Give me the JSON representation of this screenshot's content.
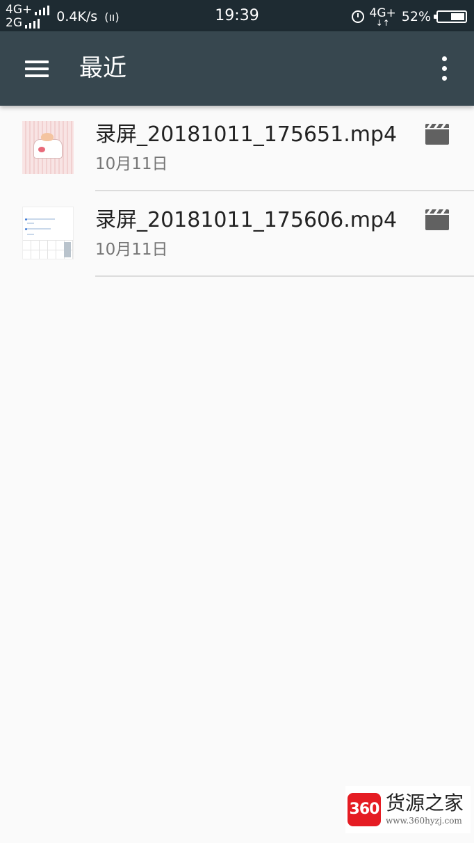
{
  "status_bar": {
    "net1": "4G+",
    "net2": "2G",
    "speed": "0.4K/s",
    "hotspot": "(ıı)",
    "time": "19:39",
    "net3": "4G+",
    "net3_arrows": "↓↑",
    "battery_text": "52%",
    "battery_level": 0.52
  },
  "toolbar": {
    "title": "最近"
  },
  "files": [
    {
      "name": "录屏_20181011_175651.mp4",
      "date": "10月11日",
      "type_icon": "video-icon",
      "thumb": "pink-cake-thumbnail"
    },
    {
      "name": "录屏_20181011_175606.mp4",
      "date": "10月11日",
      "type_icon": "video-icon",
      "thumb": "keyboard-screen-thumbnail"
    }
  ],
  "watermark": {
    "logo_text": "360",
    "name": "货源之家",
    "url": "www.360hyzj.com",
    "color": "#e51c23"
  },
  "colors": {
    "status_bar": "#1e2b32",
    "toolbar": "#37474f",
    "background": "#fafafa",
    "icon_gray": "#616161"
  }
}
